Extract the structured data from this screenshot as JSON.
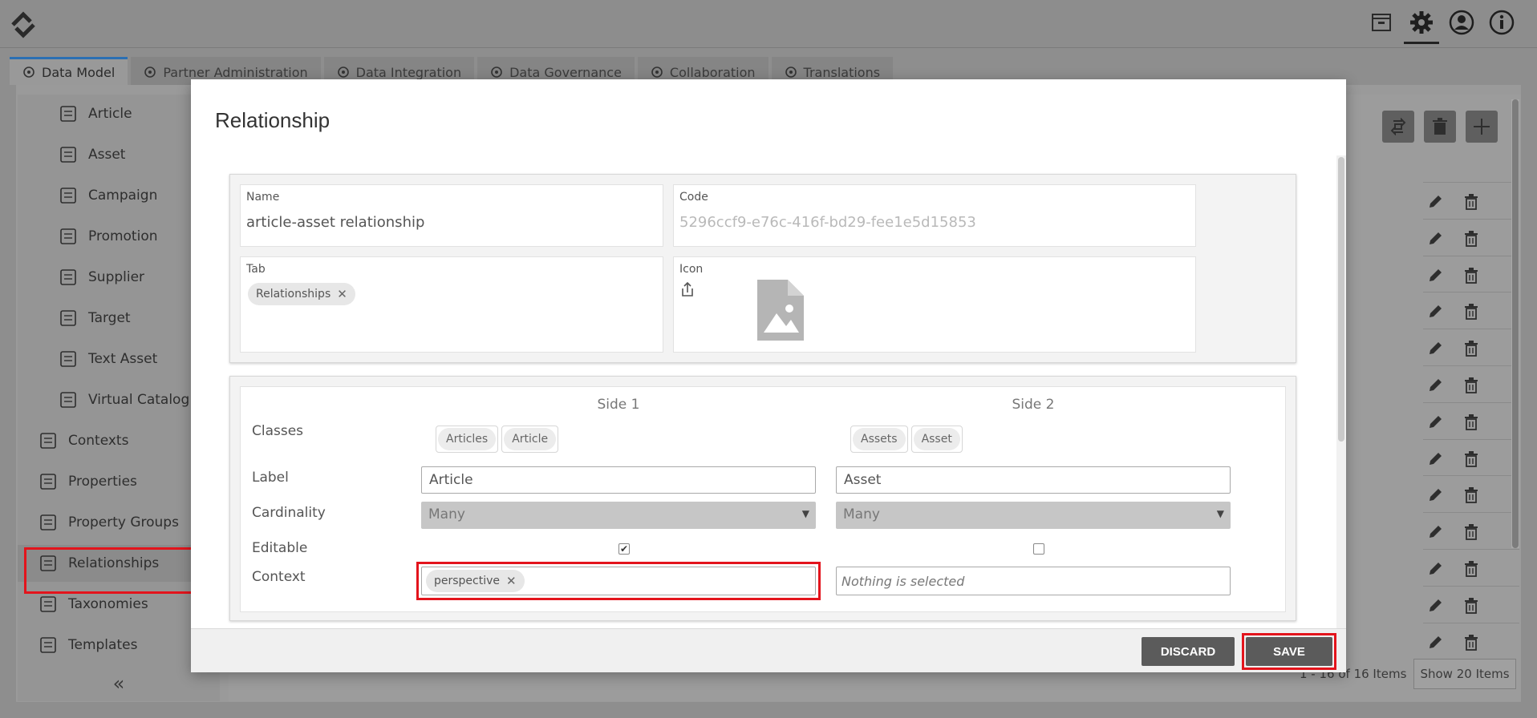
{
  "nav_tabs": [
    {
      "label": "Data Model",
      "icon": "data-model-icon",
      "active": true
    },
    {
      "label": "Partner Administration",
      "icon": "shield-icon"
    },
    {
      "label": "Data Integration",
      "icon": "share-nodes-icon"
    },
    {
      "label": "Data Governance",
      "icon": "governance-icon"
    },
    {
      "label": "Collaboration",
      "icon": "collaboration-icon"
    },
    {
      "label": "Translations",
      "icon": "translations-icon"
    }
  ],
  "top_icons": [
    "archive-icon",
    "gear-icon",
    "user-icon",
    "info-icon"
  ],
  "sidebar": {
    "items": [
      {
        "label": "Article",
        "icon": "article-icon",
        "level": "sub"
      },
      {
        "label": "Asset",
        "icon": "image-icon",
        "level": "sub"
      },
      {
        "label": "Campaign",
        "icon": "campaign-icon",
        "level": "sub"
      },
      {
        "label": "Promotion",
        "icon": "megaphone-icon",
        "level": "sub"
      },
      {
        "label": "Supplier",
        "icon": "truck-icon",
        "level": "sub"
      },
      {
        "label": "Target",
        "icon": "target-user-icon",
        "level": "sub"
      },
      {
        "label": "Text Asset",
        "icon": "text-document-icon",
        "level": "sub"
      },
      {
        "label": "Virtual Catalog",
        "icon": "catalog-icon",
        "level": "sub"
      },
      {
        "label": "Contexts",
        "icon": "tag-icon",
        "level": "top"
      },
      {
        "label": "Properties",
        "icon": "properties-icon",
        "level": "top"
      },
      {
        "label": "Property Groups",
        "icon": "property-groups-icon",
        "level": "top"
      },
      {
        "label": "Relationships",
        "icon": "relationships-icon",
        "level": "top",
        "selected": true
      },
      {
        "label": "Taxonomies",
        "icon": "taxonomies-icon",
        "level": "top"
      },
      {
        "label": "Templates",
        "icon": "templates-icon",
        "level": "top"
      }
    ],
    "collapse_label": "«"
  },
  "grid": {
    "pager_text": "1 - 16 of 16 Items",
    "page_size_label": "Show 20 Items",
    "row_count": 13
  },
  "modal": {
    "title": "Relationship",
    "name": {
      "label": "Name",
      "value": "article-asset relationship"
    },
    "code": {
      "label": "Code",
      "value": "5296ccf9-e76c-416f-bd29-fee1e5d15853"
    },
    "tab": {
      "label": "Tab",
      "chip": "Relationships"
    },
    "icon": {
      "label": "Icon",
      "upload_icon": "upload-icon",
      "preview_icon": "image-file-icon"
    },
    "sides": {
      "side1_header": "Side 1",
      "side2_header": "Side 2",
      "classes_label": "Classes",
      "label_label": "Label",
      "cardinality_label": "Cardinality",
      "editable_label": "Editable",
      "context_label": "Context",
      "side1": {
        "classes": [
          "Articles",
          "Article"
        ],
        "label": "Article",
        "cardinality": "Many",
        "editable": true,
        "context_chip": "perspective"
      },
      "side2": {
        "classes": [
          "Assets",
          "Asset"
        ],
        "label": "Asset",
        "cardinality": "Many",
        "editable": false,
        "context_placeholder": "Nothing is selected"
      }
    },
    "discard_label": "DISCARD",
    "save_label": "SAVE"
  },
  "colors": {
    "highlight": "#e3141c",
    "active_tab": "#2b6fb3",
    "button": "#5b5b5b"
  }
}
